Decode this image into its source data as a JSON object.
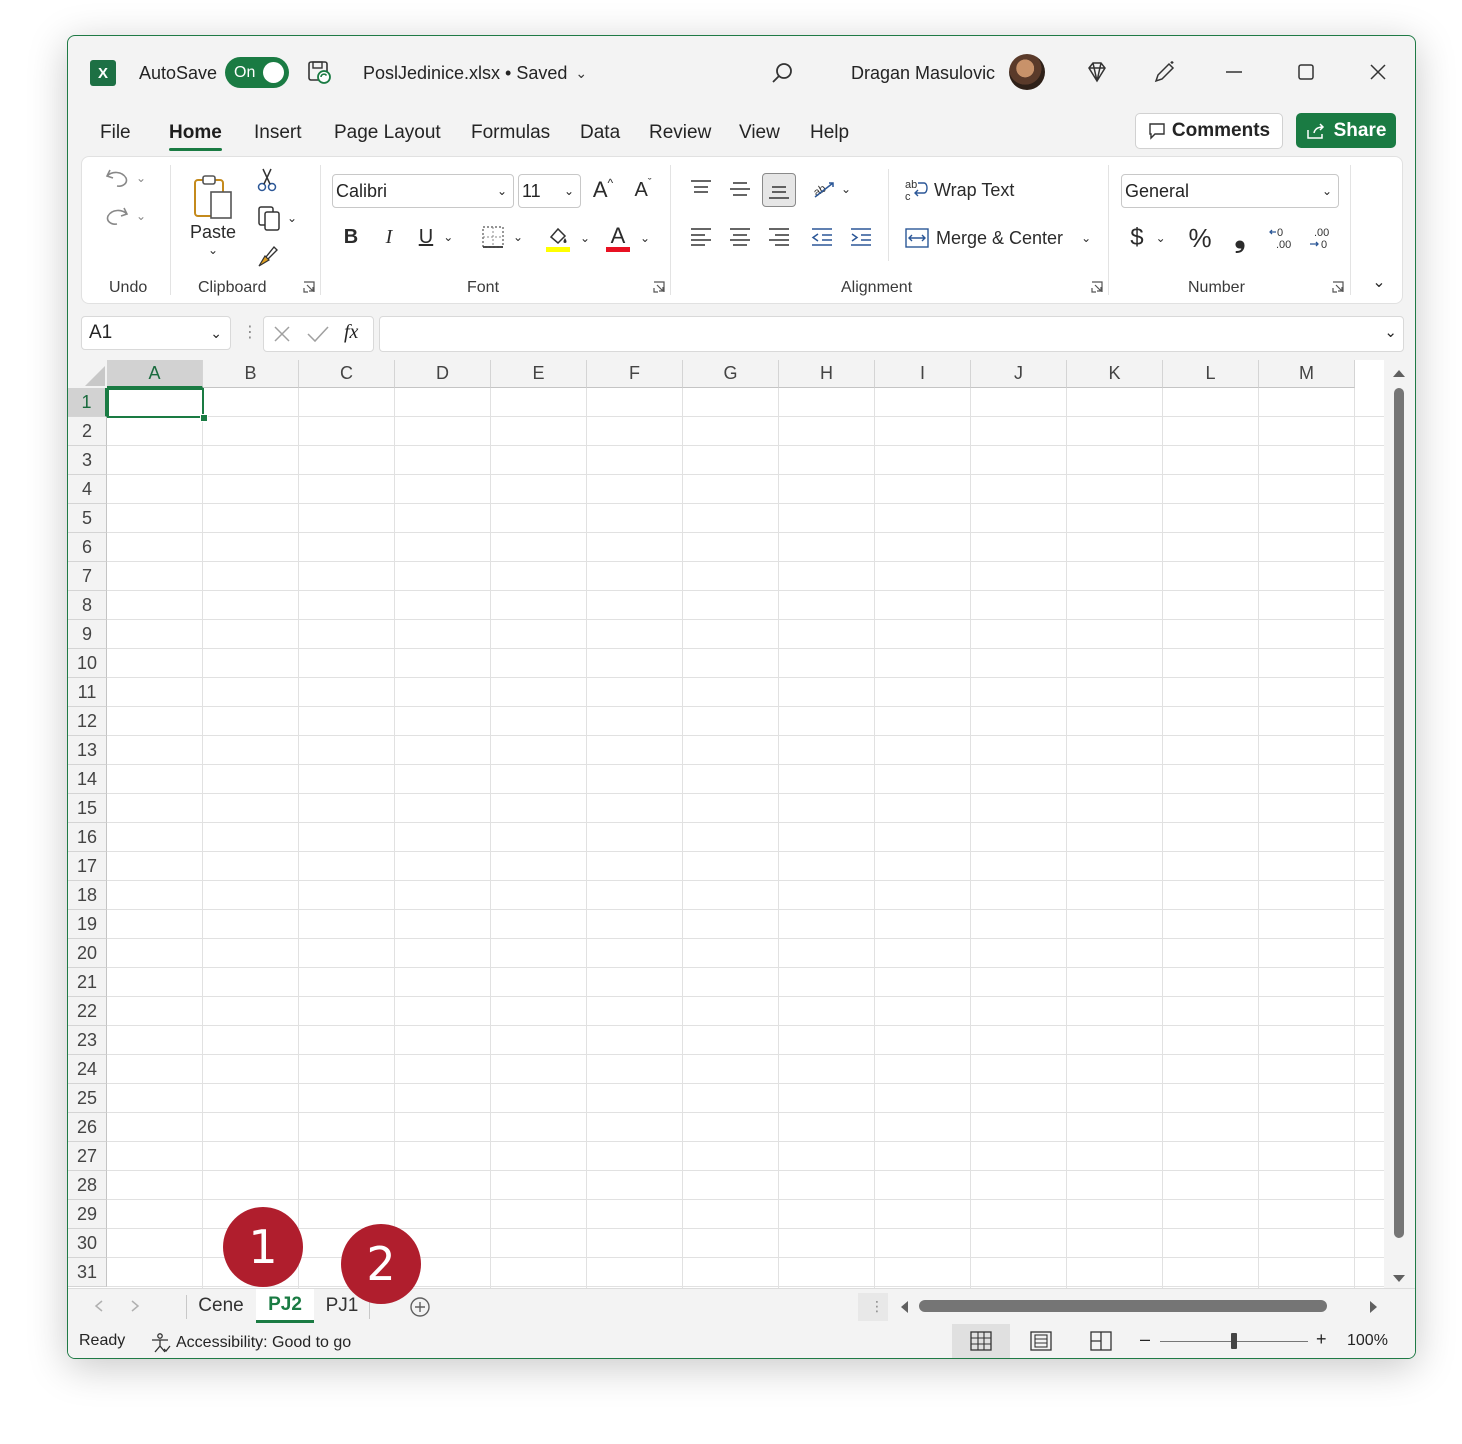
{
  "titlebar": {
    "app_icon": "excel-icon",
    "app_letter": "X",
    "autosave_label": "AutoSave",
    "autosave_state": "On",
    "filename": "PoslJedinice.xlsx • Saved",
    "user_name": "Dragan Masulovic"
  },
  "menu": {
    "tabs": [
      "File",
      "Home",
      "Insert",
      "Page Layout",
      "Formulas",
      "Data",
      "Review",
      "View",
      "Help"
    ],
    "active_tab": "Home",
    "comments_label": "Comments",
    "share_label": "Share"
  },
  "ribbon": {
    "groups": {
      "undo": "Undo",
      "clipboard": "Clipboard",
      "font": "Font",
      "alignment": "Alignment",
      "number": "Number"
    },
    "paste_label": "Paste",
    "font_name": "Calibri",
    "font_size": "11",
    "bold": "B",
    "italic": "I",
    "underline": "U",
    "wrap_text": "Wrap Text",
    "merge_center": "Merge & Center",
    "number_format": "General",
    "currency": "$",
    "percent": "%",
    "comma": "❟",
    "font_color_glyph": "A",
    "increase_font": "A",
    "decrease_font": "A",
    "colors": {
      "highlight": "#ffff00",
      "font_color": "#e81123",
      "accent": "#1a7b43"
    }
  },
  "formula_bar": {
    "name_box": "A1",
    "fx_label": "fx",
    "formula": ""
  },
  "grid": {
    "columns": [
      "A",
      "B",
      "C",
      "D",
      "E",
      "F",
      "G",
      "H",
      "I",
      "J",
      "K",
      "L",
      "M"
    ],
    "rows": [
      "1",
      "2",
      "3",
      "4",
      "5",
      "6",
      "7",
      "8",
      "9",
      "10",
      "11",
      "12",
      "13",
      "14",
      "15",
      "16",
      "17",
      "18",
      "19",
      "20",
      "21",
      "22",
      "23",
      "24",
      "25",
      "26",
      "27",
      "28",
      "29",
      "30",
      "31"
    ],
    "active_cell": "A1"
  },
  "sheets": {
    "tabs": [
      "Cene",
      "PJ2",
      "PJ1"
    ],
    "active": "PJ2"
  },
  "statusbar": {
    "ready": "Ready",
    "accessibility": "Accessibility: Good to go",
    "zoom": "100%",
    "zoom_minus": "–",
    "zoom_plus": "+"
  },
  "callouts": [
    "1",
    "2"
  ]
}
